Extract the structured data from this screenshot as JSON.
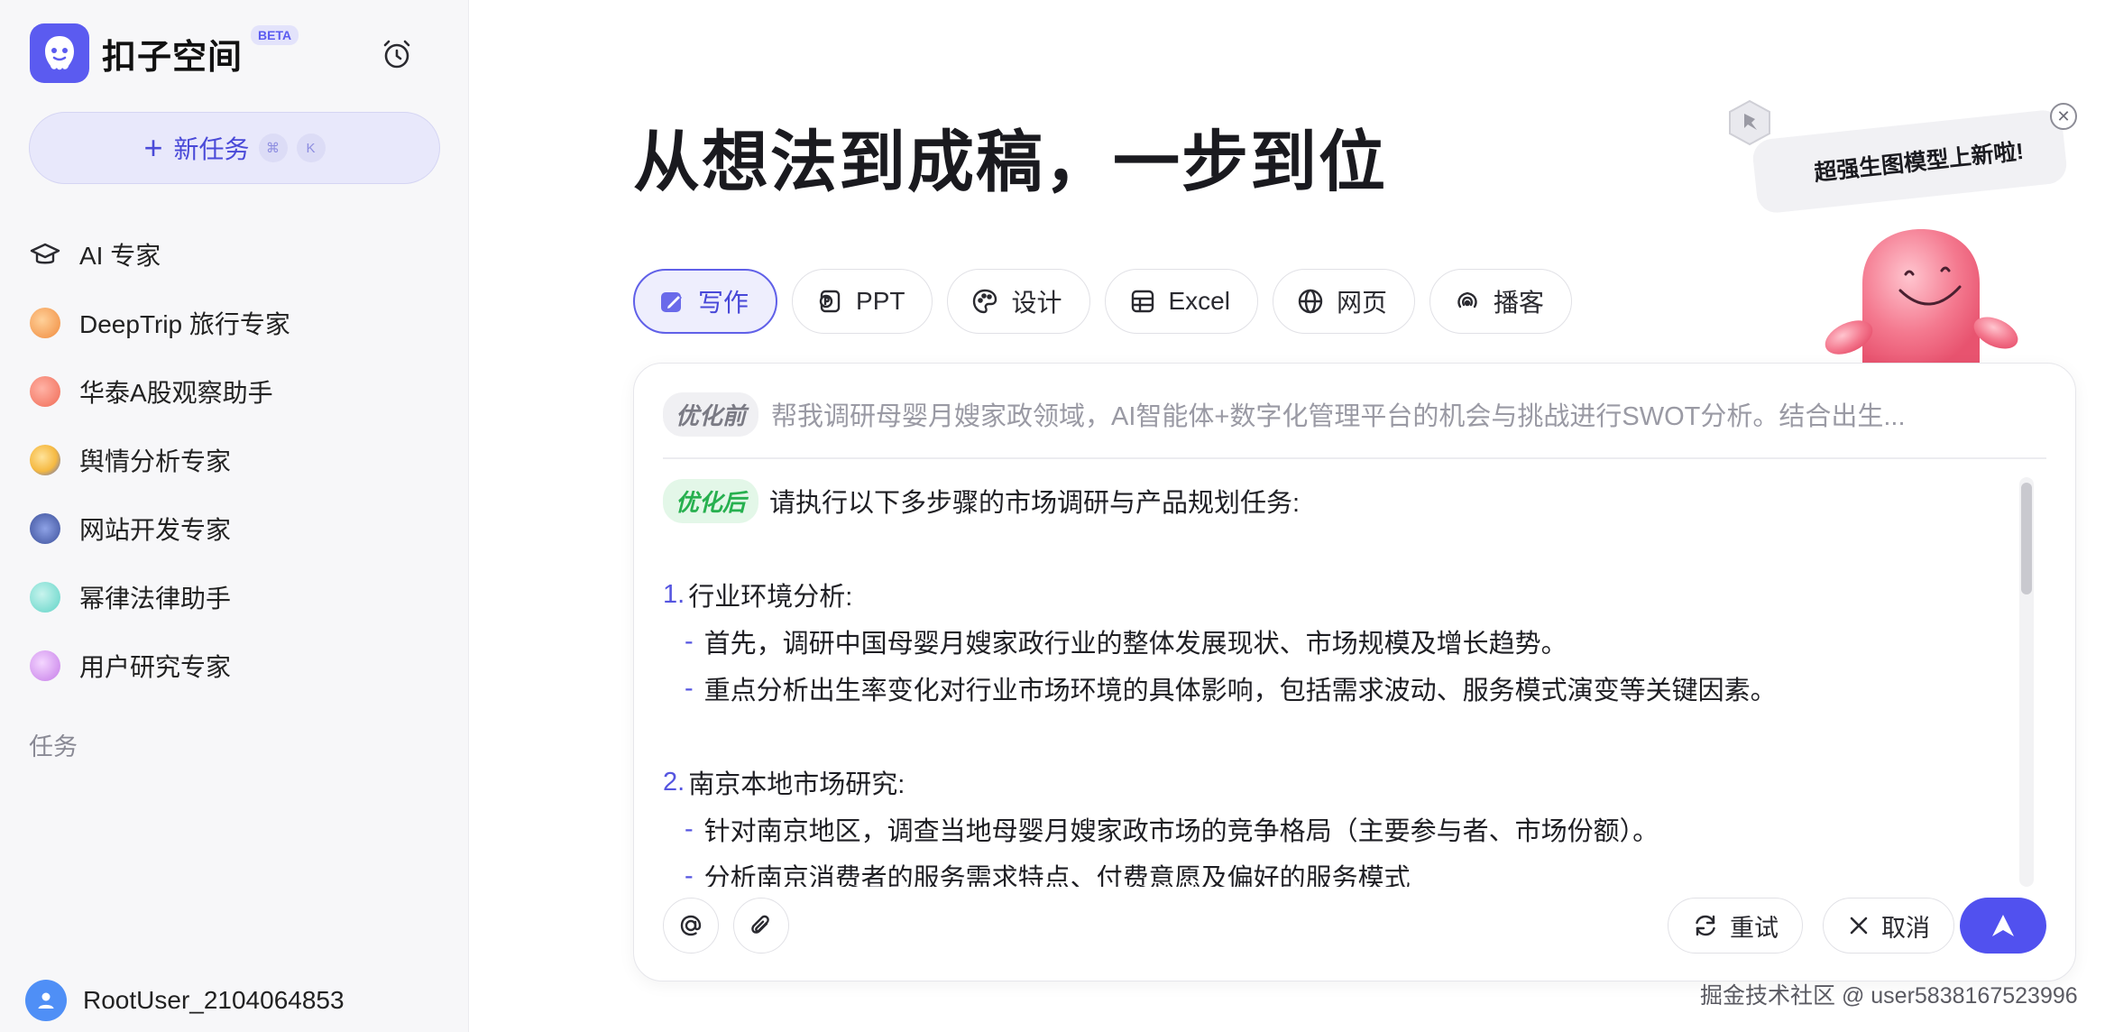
{
  "app": {
    "name": "扣子空间",
    "badge": "BETA"
  },
  "sidebar": {
    "new_task_label": "新任务",
    "shortcut_keys": [
      "⌘",
      "K"
    ],
    "items": [
      {
        "label": "AI 专家",
        "icon": "graduation-cap-icon"
      },
      {
        "label": "DeepTrip 旅行专家",
        "icon": "deeptrip-avatar",
        "color": "#f08a3c"
      },
      {
        "label": "华泰A股观察助手",
        "icon": "huatai-avatar",
        "color": "#f06a55"
      },
      {
        "label": "舆情分析专家",
        "icon": "sentiment-avatar",
        "color": "#f5b942"
      },
      {
        "label": "网站开发专家",
        "icon": "webdev-avatar",
        "color": "#3b4f9a"
      },
      {
        "label": "幂律法律助手",
        "icon": "law-avatar",
        "color": "#5fd3c6"
      },
      {
        "label": "用户研究专家",
        "icon": "user-research-avatar",
        "color": "#c57be8"
      }
    ],
    "section_label": "任务",
    "user_name": "RootUser_2104064853"
  },
  "main": {
    "headline": "从想法到成稿，一步到位",
    "promo_text": "超强生图模型上新啦!",
    "tabs": [
      {
        "label": "写作",
        "icon": "write-icon",
        "active": true
      },
      {
        "label": "PPT",
        "icon": "ppt-icon",
        "active": false
      },
      {
        "label": "设计",
        "icon": "palette-icon",
        "active": false
      },
      {
        "label": "Excel",
        "icon": "table-icon",
        "active": false
      },
      {
        "label": "网页",
        "icon": "globe-icon",
        "active": false
      },
      {
        "label": "播客",
        "icon": "podcast-icon",
        "active": false
      }
    ],
    "prompt": {
      "before_tag": "优化前",
      "before_text": "帮我调研母婴月嫂家政领域，AI智能体+数字化管理平台的机会与挑战进行SWOT分析。结合出生...",
      "after_tag": "优化后",
      "after_intro": "请执行以下多步骤的市场调研与产品规划任务:",
      "sections": [
        {
          "num": "1.",
          "title": "行业环境分析:",
          "items": [
            "首先，调研中国母婴月嫂家政行业的整体发展现状、市场规模及增长趋势。",
            "重点分析出生率变化对行业市场环境的具体影响，包括需求波动、服务模式演变等关键因素。"
          ]
        },
        {
          "num": "2.",
          "title": "南京本地市场研究:",
          "items": [
            "针对南京地区，调查当地母婴月嫂家政市场的竞争格局（主要参与者、市场份额）。",
            "分析南京消费者的服务需求特点、付费意愿及偏好的服务模式"
          ]
        }
      ]
    },
    "actions": {
      "retry_label": "重试",
      "cancel_label": "取消"
    }
  },
  "watermark": "掘金技术社区 @ user5838167523996",
  "colors": {
    "accent": "#5151ef",
    "after_tag_green": "#27b04f",
    "sidebar_bg": "#f7f7f9"
  }
}
